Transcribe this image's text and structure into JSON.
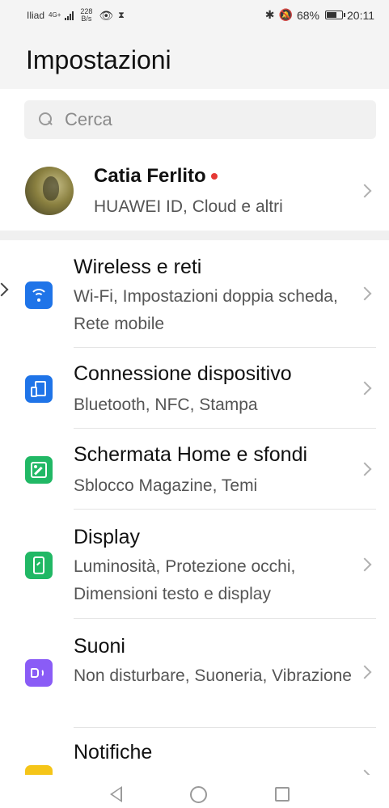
{
  "status_bar": {
    "carrier": "Iliad",
    "network": "4G+",
    "speed_value": "228",
    "speed_unit": "B/s",
    "battery": "68%",
    "battery_level": 0.68,
    "time": "20:11",
    "icons": [
      "signal-icon",
      "eye-icon",
      "hourglass-icon",
      "bluetooth-icon",
      "mute-icon",
      "battery-icon"
    ]
  },
  "header": {
    "title": "Impostazioni"
  },
  "search": {
    "placeholder": "Cerca"
  },
  "account": {
    "name": "Catia Ferlito",
    "subtitle": "HUAWEI ID, Cloud e altri",
    "has_notification_dot": true,
    "dot_color": "#e53935"
  },
  "settings": [
    {
      "title": "Wireless e reti",
      "subtitle": "Wi-Fi, Impostazioni doppia scheda, Rete mobile",
      "icon": "wifi-icon",
      "color": "#1f74e8"
    },
    {
      "title": "Connessione dispositivo",
      "subtitle": "Bluetooth, NFC, Stampa",
      "icon": "device-connection-icon",
      "color": "#1f74e8"
    },
    {
      "title": "Schermata Home e sfondi",
      "subtitle": "Sblocco Magazine, Temi",
      "icon": "wallpaper-icon",
      "color": "#21b865"
    },
    {
      "title": "Display",
      "subtitle": "Luminosità, Protezione occhi, Dimensioni testo e display",
      "icon": "display-icon",
      "color": "#21b865"
    },
    {
      "title": "Suoni",
      "subtitle": "Non disturbare, Suoneria, Vibrazione",
      "icon": "sound-icon",
      "color": "#8a5cf6"
    },
    {
      "title": "Notifiche",
      "subtitle": "",
      "icon": "notification-icon",
      "color": "#f5c518"
    }
  ],
  "nav_bar": {
    "buttons": [
      "back",
      "home",
      "recents"
    ]
  }
}
